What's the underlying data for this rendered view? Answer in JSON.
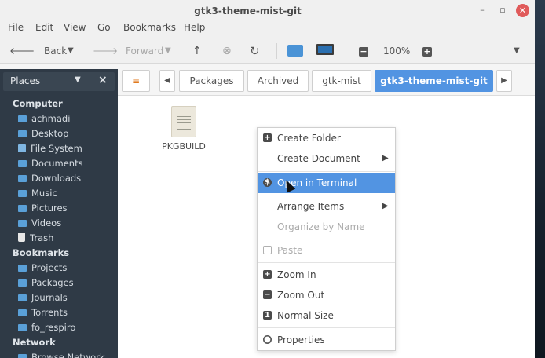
{
  "window": {
    "title": "gtk3-theme-mist-git",
    "controls": {
      "minimize": "–",
      "maximize": "▫",
      "close": "✕"
    }
  },
  "menubar": [
    "File",
    "Edit",
    "View",
    "Go",
    "Bookmarks",
    "Help"
  ],
  "toolbar": {
    "back": "Back",
    "forward": "Forward",
    "zoom": "100%"
  },
  "sidebar": {
    "header": "Places",
    "sections": [
      {
        "title": "Computer",
        "items": [
          "achmadi",
          "Desktop",
          "File System",
          "Documents",
          "Downloads",
          "Music",
          "Pictures",
          "Videos",
          "Trash"
        ]
      },
      {
        "title": "Bookmarks",
        "items": [
          "Projects",
          "Packages",
          "Journals",
          "Torrents",
          "fo_respiro"
        ]
      },
      {
        "title": "Network",
        "items": [
          "Browse Network"
        ]
      }
    ]
  },
  "pathbar": [
    "Packages",
    "Archived",
    "gtk-mist",
    "gtk3-theme-mist-git"
  ],
  "files": [
    {
      "name": "PKGBUILD"
    }
  ],
  "context_menu": {
    "items": [
      {
        "label": "Create Folder",
        "icon": "plus-icon",
        "submenu": false,
        "disabled": false,
        "highlighted": false
      },
      {
        "label": "Create Document",
        "icon": "",
        "submenu": true,
        "disabled": false,
        "highlighted": false
      },
      {
        "label": "Open in Terminal",
        "icon": "terminal-icon",
        "submenu": false,
        "disabled": false,
        "highlighted": true
      },
      {
        "label": "Arrange Items",
        "icon": "",
        "submenu": true,
        "disabled": false,
        "highlighted": false
      },
      {
        "label": "Organize by Name",
        "icon": "",
        "submenu": false,
        "disabled": true,
        "highlighted": false
      },
      {
        "label": "Paste",
        "icon": "clipboard-icon",
        "submenu": false,
        "disabled": true,
        "highlighted": false
      },
      {
        "label": "Zoom In",
        "icon": "plus-icon",
        "submenu": false,
        "disabled": false,
        "highlighted": false
      },
      {
        "label": "Zoom Out",
        "icon": "minus-icon",
        "submenu": false,
        "disabled": false,
        "highlighted": false
      },
      {
        "label": "Normal Size",
        "icon": "one-icon",
        "submenu": false,
        "disabled": false,
        "highlighted": false
      },
      {
        "label": "Properties",
        "icon": "eye-icon",
        "submenu": false,
        "disabled": false,
        "highlighted": false
      }
    ]
  },
  "colors": {
    "accent": "#5294e2",
    "sidebar_bg": "#2f3a46",
    "close": "#e05a5a"
  }
}
